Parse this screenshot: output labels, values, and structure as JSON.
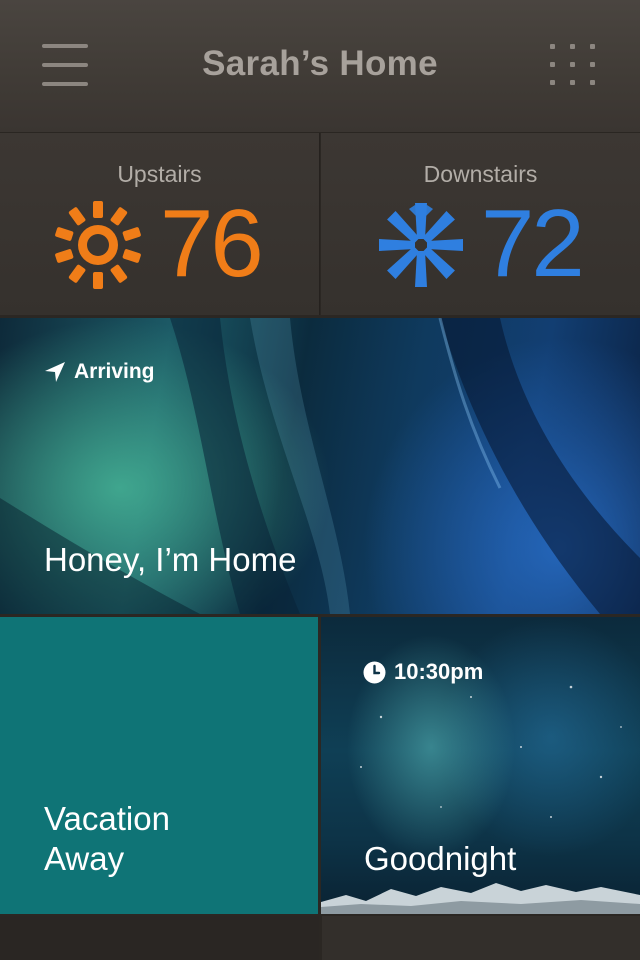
{
  "header": {
    "title": "Sarah’s Home",
    "menu_icon": "hamburger-menu-icon",
    "apps_icon": "grid-apps-icon"
  },
  "zones": [
    {
      "label": "Upstairs",
      "temperature": "76",
      "mode_icon": "sun-heat-icon",
      "color": "#f07d18"
    },
    {
      "label": "Downstairs",
      "temperature": "72",
      "mode_icon": "snowflake-cool-icon",
      "color": "#2f7fe0"
    }
  ],
  "scenes": {
    "honey": {
      "trigger_icon": "location-arrow-icon",
      "trigger": "Arriving",
      "name": "Honey, I’m Home"
    },
    "vacation": {
      "name_line1": "Vacation",
      "name_line2": "Away",
      "color": "#0f7476"
    },
    "goodnight": {
      "trigger_icon": "clock-icon",
      "trigger": "10:30pm",
      "name": "Goodnight"
    }
  }
}
